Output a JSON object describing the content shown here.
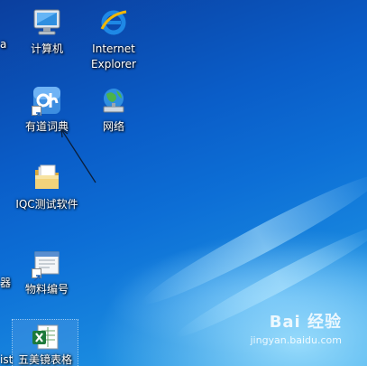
{
  "desktop": {
    "icons": [
      {
        "name": "computer",
        "label": "计算机",
        "glyph": "monitor-icon"
      },
      {
        "name": "internet-explorer",
        "label": "Internet Explorer",
        "glyph": "ie-icon"
      },
      {
        "name": "youdao-dictionary",
        "label": "有道词典",
        "glyph": "youdao-icon"
      },
      {
        "name": "network",
        "label": "网络",
        "glyph": "network-globe-icon"
      },
      {
        "name": "iqc-software",
        "label": "IQC测试软件",
        "glyph": "folder-icon"
      },
      {
        "name": "material-number",
        "label": "物料编号",
        "glyph": "document-shortcut-icon"
      },
      {
        "name": "spreadsheet",
        "label": "五美镜表格",
        "glyph": "excel-icon"
      }
    ],
    "partial_labels": {
      "row1": "a",
      "row3": "器",
      "row4": "ist"
    }
  },
  "watermark": {
    "brand": "Bai 经验",
    "url": "jingyan.baidu.com"
  },
  "colors": {
    "desktop_blue": "#0a5dc8",
    "ie_blue": "#1e88e5",
    "excel_green": "#1d7a3a"
  }
}
